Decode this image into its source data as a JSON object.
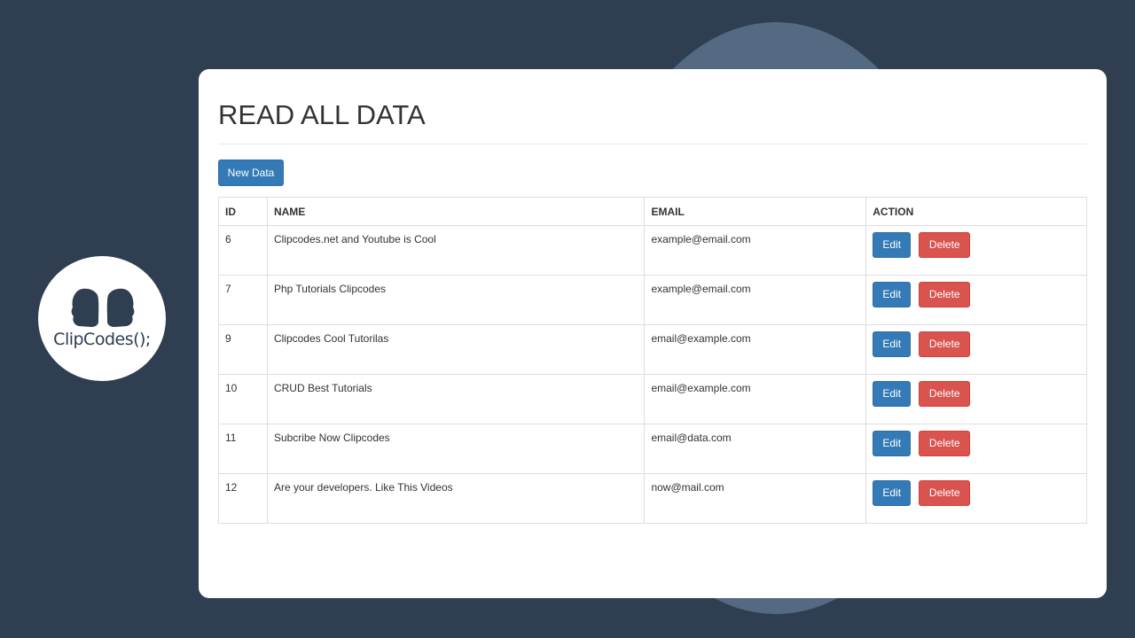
{
  "brand": {
    "logo_text": "ClipCodes();",
    "colors": {
      "background": "#2f3e50",
      "ellipse": "#536a82",
      "primary": "#337ab7",
      "danger": "#d9534f"
    }
  },
  "page": {
    "title": "READ ALL DATA",
    "new_button_label": "New Data"
  },
  "table": {
    "headers": [
      "ID",
      "NAME",
      "EMAIL",
      "ACTION"
    ],
    "rows": [
      {
        "id": "6",
        "name": "Clipcodes.net and Youtube is Cool",
        "email": "example@email.com"
      },
      {
        "id": "7",
        "name": "Php Tutorials Clipcodes",
        "email": "example@email.com"
      },
      {
        "id": "9",
        "name": "Clipcodes Cool Tutorilas",
        "email": "email@example.com"
      },
      {
        "id": "10",
        "name": "CRUD Best Tutorials",
        "email": "email@example.com"
      },
      {
        "id": "11",
        "name": "Subcribe Now Clipcodes",
        "email": "email@data.com"
      },
      {
        "id": "12",
        "name": "Are your developers. Like This Videos",
        "email": "now@mail.com"
      }
    ],
    "edit_label": "Edit",
    "delete_label": "Delete"
  }
}
